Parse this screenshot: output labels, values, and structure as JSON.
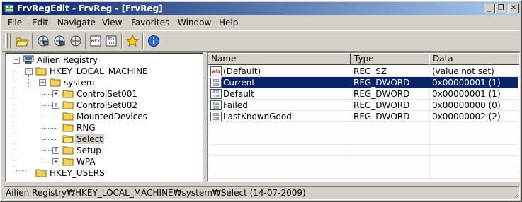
{
  "window": {
    "title": "FrvRegEdit - FrvReg - [FrvReg]",
    "minimize": "_",
    "restore": "❐",
    "close": "✕"
  },
  "menu": [
    "File",
    "Edit",
    "Navigate",
    "View",
    "Favorites",
    "Window",
    "Help"
  ],
  "toolbar": {
    "icons": [
      "open-folder-icon",
      "connect-icon",
      "disconnect-icon",
      "network-icon",
      "hex-string-icon",
      "binary-icon",
      "favorites-star-icon",
      "info-icon"
    ]
  },
  "tree": {
    "root": "Ailien Registry",
    "hklm": "HKEY_LOCAL_MACHINE",
    "system": "system",
    "children": [
      "ControlSet001",
      "ControlSet002",
      "MountedDevices",
      "RNG",
      "Select",
      "Setup",
      "WPA"
    ],
    "selected": "Select",
    "hku": "HKEY_USERS"
  },
  "list": {
    "columns": [
      "Name",
      "Type",
      "Data"
    ],
    "rows": [
      {
        "name": "(Default)",
        "type": "REG_SZ",
        "data": "(value not set)",
        "icon": "string-value-icon"
      },
      {
        "name": "Current",
        "type": "REG_DWORD",
        "data": "0x00000001 (1)",
        "icon": "dword-value-icon"
      },
      {
        "name": "Default",
        "type": "REG_DWORD",
        "data": "0x00000001 (1)",
        "icon": "dword-value-icon"
      },
      {
        "name": "Failed",
        "type": "REG_DWORD",
        "data": "0x00000000 (0)",
        "icon": "dword-value-icon"
      },
      {
        "name": "LastKnownGood",
        "type": "REG_DWORD",
        "data": "0x00000002 (2)",
        "icon": "dword-value-icon"
      }
    ],
    "selected_row": "Current"
  },
  "status": {
    "path": "Ailien Registry₩HKEY_LOCAL_MACHINE₩system₩Select (14-07-2009)"
  },
  "colors": {
    "title_start": "#0a246a",
    "title_end": "#a6caf0",
    "selection": "#0a246a",
    "face": "#d4d0c8"
  }
}
